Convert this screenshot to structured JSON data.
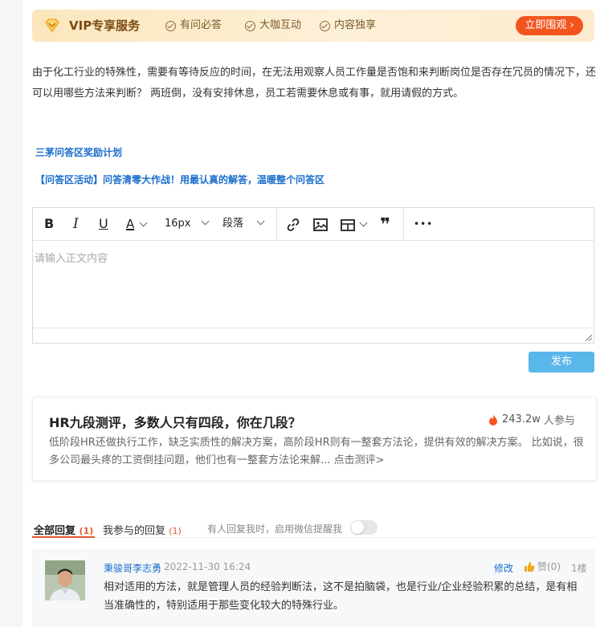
{
  "vip": {
    "title": "VIP专享服务",
    "features": [
      "有问必答",
      "大咖互动",
      "内容独享"
    ],
    "cta": "立即围观 ›"
  },
  "question": {
    "text": "由于化工行业的特殊性，需要有等待反应的时间，在无法用观察人员工作量是否饱和来判断岗位是否存在冗员的情况下，还可以用哪些方法来判断？ 两班倒，没有安排休息，员工若需要休息或有事，就用请假的方式。"
  },
  "links": {
    "reward_plan": "三茅问答区奖励计划",
    "activity": "【问答区活动】问答清零大作战！用最认真的解答，温暖整个问答区"
  },
  "editor": {
    "font_size": "16px",
    "block_type": "段落",
    "placeholder": "请输入正文内容",
    "more": "•••"
  },
  "publish_label": "发布",
  "promo": {
    "title": "HR九段测评，多数人只有四段，你在几段？",
    "participants": "243.2w",
    "participants_suffix": "人参与",
    "description": "低阶段HR还做执行工作，缺乏实质性的解决方案，高阶段HR则有一整套方法论，提供有效的解决方案。 比如说，很多公司最头疼的工资倒挂问题，他们也有一整套方法论来解... 点击测评>"
  },
  "tabs": {
    "all_label": "全部回复",
    "all_count": "(1)",
    "mine_label": "我参与的回复",
    "mine_count": "(1)",
    "notify_text": "有人回复我时，启用微信提醒我",
    "notify_enabled": false
  },
  "reply": {
    "author": "秉骏哥李志勇",
    "time": "2022-11-30 16:24",
    "edit": "修改",
    "like": "赞(0)",
    "floor": "1楼",
    "text": "相对适用的方法，就是管理人员的经验判断法，这不是拍脑袋，也是行业/企业经验积累的总结，是有相当准确性的，特别适用于那些变化较大的特殊行业。"
  },
  "colors": {
    "accent_orange": "#f3541d",
    "link_blue": "#1a6dcc",
    "publish_blue": "#5ab7ea"
  }
}
